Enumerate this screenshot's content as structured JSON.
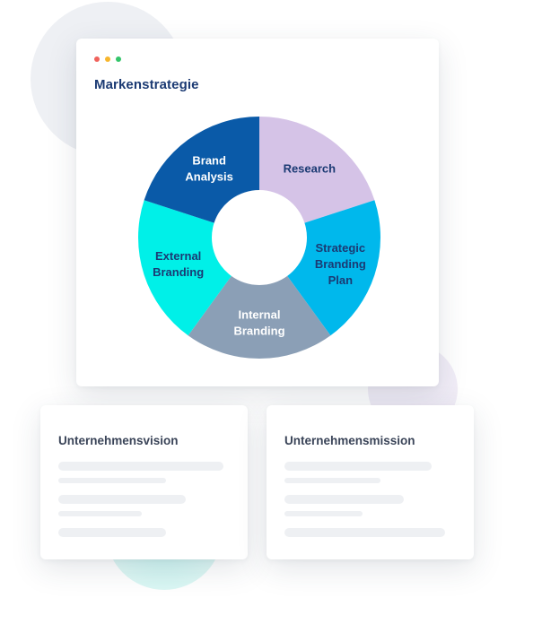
{
  "window": {
    "controls": [
      {
        "name": "close",
        "color": "#f0625c"
      },
      {
        "name": "minimize",
        "color": "#f7b62d"
      },
      {
        "name": "maximize",
        "color": "#33c56a"
      }
    ]
  },
  "main_card": {
    "title": "Markenstrategie"
  },
  "diagram": {
    "type": "donut",
    "segments": [
      {
        "lines": [
          "Research"
        ],
        "color": "#d5c3e7",
        "text_color": "#1b3a73"
      },
      {
        "lines": [
          "Strategic",
          "Branding",
          "Plan"
        ],
        "color": "#00b8ec",
        "text_color": "#1b3a73"
      },
      {
        "lines": [
          "Internal",
          "Branding"
        ],
        "color": "#8b9fb6",
        "text_color": "#ffffff"
      },
      {
        "lines": [
          "External",
          "Branding"
        ],
        "color": "#00f0e8",
        "text_color": "#1b3a73"
      },
      {
        "lines": [
          "Brand",
          "Analysis"
        ],
        "color": "#0a5aa8",
        "text_color": "#ffffff"
      }
    ]
  },
  "cards": {
    "vision": {
      "title": "Unternehmensvision"
    },
    "mission": {
      "title": "Unternehmensmission"
    }
  },
  "colors": {
    "title": "#1b3a73",
    "placeholder_bar": "#eef0f3"
  }
}
